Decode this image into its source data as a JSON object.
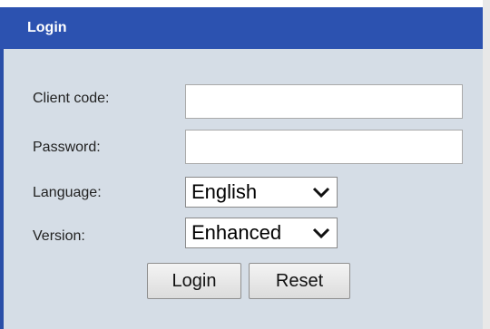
{
  "form": {
    "title": "Login",
    "fields": {
      "client_code": {
        "label": "Client code:",
        "value": ""
      },
      "password": {
        "label": "Password:",
        "value": ""
      },
      "language": {
        "label": "Language:",
        "value": "English"
      },
      "version": {
        "label": "Version:",
        "value": "Enhanced"
      }
    },
    "buttons": {
      "login": "Login",
      "reset": "Reset"
    }
  },
  "colors": {
    "title_bar": "#2c52b0",
    "panel_background": "#d5dde6"
  },
  "icons": {
    "dropdown": "chevron-down-icon"
  }
}
